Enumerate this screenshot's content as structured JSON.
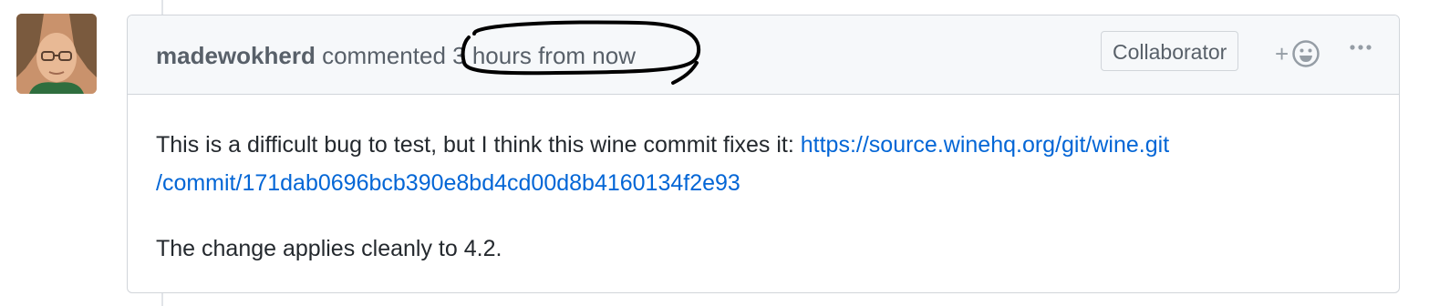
{
  "comment": {
    "author": "madewokherd",
    "action": "commented",
    "timestamp": "3 hours from now",
    "badge": "Collaborator",
    "reaction_plus": "+",
    "reaction_icon": "smiley-icon",
    "more_icon": "kebab-horizontal-icon",
    "body": {
      "p1_text": "This is a difficult bug to test, but I think this wine commit fixes it: ",
      "link_line1": "https://source.winehq.org/git/wine.git",
      "link_line2": "/commit/171dab0696bcb390e8bd4cd00d8b4160134f2e93",
      "p2": "The change applies cleanly to 4.2."
    }
  },
  "colors": {
    "link": "#0366d6",
    "header_bg": "#f6f8fa",
    "border": "#d1d5da",
    "muted_text": "#586069",
    "annotation": "#000000"
  }
}
